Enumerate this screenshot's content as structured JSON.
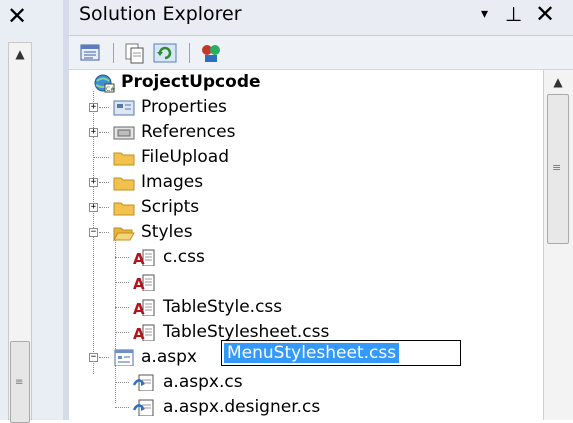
{
  "left_pane": {
    "close_glyph": "✕"
  },
  "solution_explorer": {
    "title": "Solution Explorer",
    "dropdown_glyph": "▾",
    "pin_glyph": "⊥",
    "close_glyph": "✕",
    "toolbar": [
      {
        "name": "properties-icon"
      },
      {
        "name": "show-all-files-icon"
      },
      {
        "name": "refresh-icon"
      },
      {
        "name": "class-diagram-icon"
      }
    ],
    "tree": {
      "root": "ProjectUpcode",
      "properties": "Properties",
      "references": "References",
      "fileupload": "FileUpload",
      "images": "Images",
      "scripts": "Scripts",
      "styles": "Styles",
      "c_css": "c.css",
      "menu_stylesheet_rename": "MenuStylesheet.css",
      "tablestyle": "TableStyle.css",
      "tablestylesheet": "TableStylesheet.css",
      "a_aspx": "a.aspx",
      "a_aspx_cs": "a.aspx.cs",
      "a_aspx_designer": "a.aspx.designer.cs"
    }
  },
  "colors": {
    "selection": "#3399ff",
    "folder": "#f2c14e",
    "title_bar": "#e9ecf2"
  }
}
